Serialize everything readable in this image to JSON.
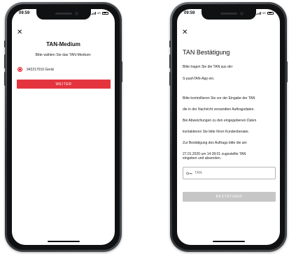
{
  "screens": [
    {
      "status": {
        "time": "09:59",
        "network": "4G"
      },
      "close_icon": "close-icon",
      "title": "TAN-Medium",
      "subtitle": "Bitte wählen Sie das TAN-Medium:",
      "option": {
        "label": "942217010 Gerät",
        "selected": true
      },
      "button": {
        "label": "WEITER",
        "color": "#e4353f"
      }
    },
    {
      "status": {
        "time": "09:59",
        "network": "4G"
      },
      "close_icon": "close-icon",
      "title": "TAN Bestätigung",
      "intro_lines": [
        "Bitte tragen Sie die TAN aus der",
        "S-pushTAN-App ein."
      ],
      "body_lines": [
        "Bitte kontrollieren Sie vor der Eingabe der TAN",
        "die in der Nachricht versandten Auftragsdaten.",
        "Bei Abweichungen zu den eingegebenen Daten",
        "kontaktieren Sie bitte Ihren Kundenberater.",
        "Zur Bestätigung des Auftrags bitte die am",
        "27.01.2020 um 14:39:01 zugestellte TAN",
        "eingeben und absenden."
      ],
      "tan_input": {
        "placeholder": "TAN",
        "value": "",
        "icon": "key-icon"
      },
      "button": {
        "label": "BESTÄTIGEN",
        "color": "#c6c6c6",
        "disabled": true
      }
    }
  ],
  "colors": {
    "accent": "#e30613",
    "disabled": "#c6c6c6"
  }
}
